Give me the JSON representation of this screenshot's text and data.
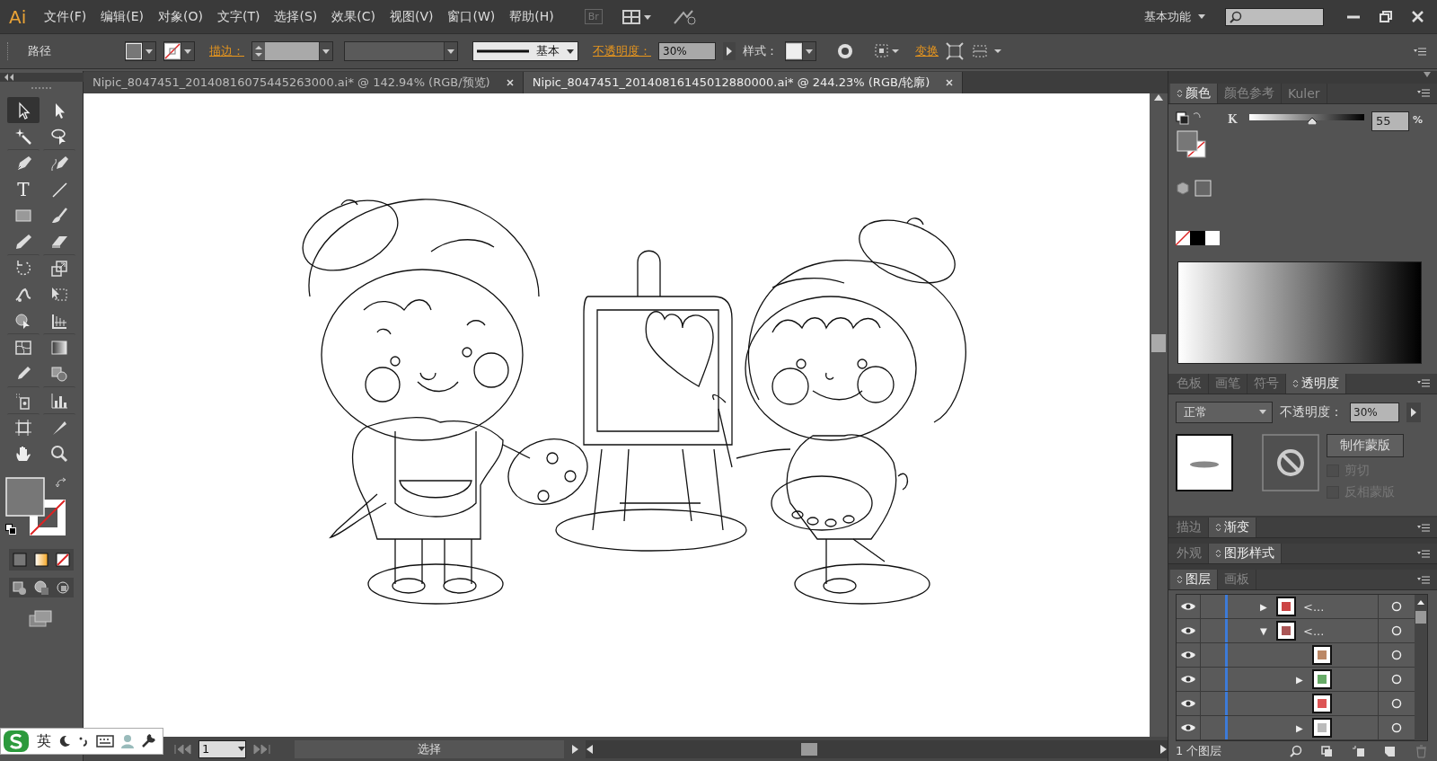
{
  "menu_bar": {
    "logo": "Ai",
    "menus": [
      "文件(F)",
      "编辑(E)",
      "对象(O)",
      "文字(T)",
      "选择(S)",
      "效果(C)",
      "视图(V)",
      "窗口(W)",
      "帮助(H)"
    ],
    "bridge": "Br",
    "workspace": "基本功能"
  },
  "control_bar": {
    "selection": "路径",
    "stroke_label": "描边：",
    "stroke_profile": "基本",
    "opacity_label": "不透明度：",
    "opacity": "30%",
    "style_label": "样式：",
    "transform": "变换"
  },
  "document_tabs": [
    {
      "title": "Nipic_8047451_20140816075445263000.ai* @ 142.94% (RGB/预览)",
      "selected": false
    },
    {
      "title": "Nipic_8047451_20140816145012880000.ai* @ 244.23% (RGB/轮廓)",
      "selected": true
    }
  ],
  "tools": [
    {
      "kind": "select",
      "selected": true
    },
    {
      "kind": "direct",
      "selected": false
    },
    {
      "kind": "wand",
      "selected": false
    },
    {
      "kind": "lasso",
      "selected": false
    },
    {
      "kind": "pen",
      "selected": false
    },
    {
      "kind": "curvature",
      "selected": false
    },
    {
      "kind": "type",
      "glyph": "T",
      "selected": false
    },
    {
      "kind": "line",
      "selected": false
    },
    {
      "kind": "rect",
      "selected": false
    },
    {
      "kind": "brush",
      "selected": false
    },
    {
      "kind": "pencil",
      "selected": false
    },
    {
      "kind": "eraser",
      "selected": false
    },
    {
      "kind": "rotate",
      "selected": false
    },
    {
      "kind": "scale",
      "selected": false
    },
    {
      "kind": "warp",
      "selected": false
    },
    {
      "kind": "freetransform",
      "selected": false
    },
    {
      "kind": "shapebuilder",
      "selected": false
    },
    {
      "kind": "perspective",
      "selected": false
    },
    {
      "kind": "mesh",
      "selected": false
    },
    {
      "kind": "gradient",
      "selected": false
    },
    {
      "kind": "eyedropper",
      "selected": false
    },
    {
      "kind": "blend",
      "selected": false
    },
    {
      "kind": "sprayer",
      "selected": false
    },
    {
      "kind": "graph",
      "selected": false
    },
    {
      "kind": "artboard",
      "selected": false
    },
    {
      "kind": "slice",
      "selected": false
    },
    {
      "kind": "hand",
      "selected": false
    },
    {
      "kind": "zoom",
      "selected": false
    }
  ],
  "color_panel": {
    "tabs": [
      {
        "label": "颜色",
        "selected": true
      },
      {
        "label": "颜色参考",
        "selected": false
      },
      {
        "label": "Kuler",
        "selected": false
      }
    ],
    "channel": "K",
    "level": 0.55,
    "value": "55",
    "unit": "%"
  },
  "transparency_panel": {
    "tabs": [
      {
        "label": "色板",
        "selected": false
      },
      {
        "label": "画笔",
        "selected": false
      },
      {
        "label": "符号",
        "selected": false
      },
      {
        "label": "透明度",
        "selected": true
      }
    ],
    "blend_mode": "正常",
    "opacity_label": "不透明度：",
    "opacity": "30%",
    "mask_button": "制作蒙版",
    "options": [
      {
        "label": "剪切",
        "checked": false,
        "disabled": true
      },
      {
        "label": "反相蒙版",
        "checked": false,
        "disabled": true
      }
    ]
  },
  "stroke_panel": {
    "tabs": [
      {
        "label": "描边",
        "selected": false
      },
      {
        "label": "渐变",
        "selected": true
      }
    ]
  },
  "appearance_panel": {
    "tabs": [
      {
        "label": "外观",
        "selected": false
      },
      {
        "label": "图形样式",
        "selected": true
      }
    ]
  },
  "layers_panel": {
    "tabs": [
      {
        "label": "图层",
        "selected": true
      },
      {
        "label": "画板",
        "selected": false
      }
    ],
    "rows": [
      {
        "arrow": "▶",
        "name": "<..."
      },
      {
        "arrow": "▼",
        "name": "<..."
      },
      {},
      {
        "arrow": "▶"
      },
      {},
      {
        "arrow": "▶"
      }
    ],
    "count": "1 个图层"
  },
  "status_bar": {
    "page": "1",
    "status": "选择"
  },
  "ime_bar": {
    "mode": "英"
  }
}
